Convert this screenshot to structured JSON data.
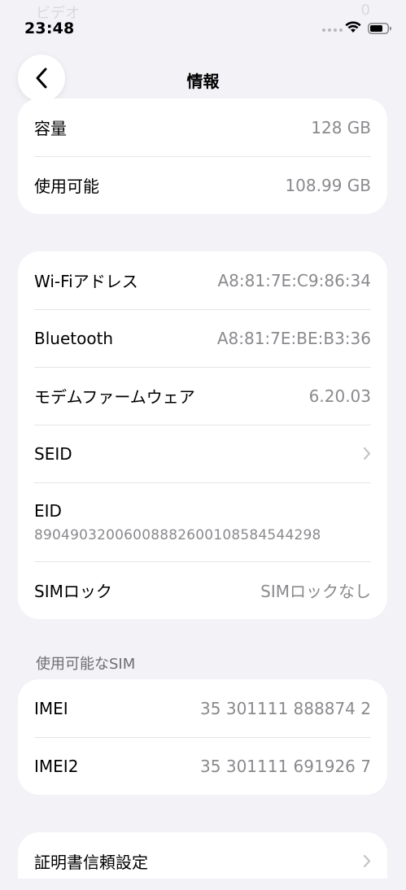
{
  "status_bar": {
    "time": "23:48",
    "ghost_label": "ビデオ",
    "ghost_value": "0"
  },
  "nav": {
    "title": "情報"
  },
  "storage": {
    "rows": [
      {
        "label": "容量",
        "value": "128 GB"
      },
      {
        "label": "使用可能",
        "value": "108.99 GB"
      }
    ]
  },
  "network": {
    "rows": [
      {
        "label": "Wi-Fiアドレス",
        "value": "A8:81:7E:C9:86:34"
      },
      {
        "label": "Bluetooth",
        "value": "A8:81:7E:BE:B3:36"
      },
      {
        "label": "モデムファームウェア",
        "value": "6.20.03"
      },
      {
        "label": "SEID",
        "value": ""
      },
      {
        "label": "EID",
        "value": "89049032006008882600108584544298"
      },
      {
        "label": "SIMロック",
        "value": "SIMロックなし"
      }
    ]
  },
  "sim_section": {
    "header": "使用可能なSIM",
    "rows": [
      {
        "label": "IMEI",
        "value": "35 301111 888874 2"
      },
      {
        "label": "IMEI2",
        "value": "35 301111 691926 7"
      }
    ]
  },
  "cert": {
    "rows": [
      {
        "label": "証明書信頼設定"
      }
    ]
  }
}
